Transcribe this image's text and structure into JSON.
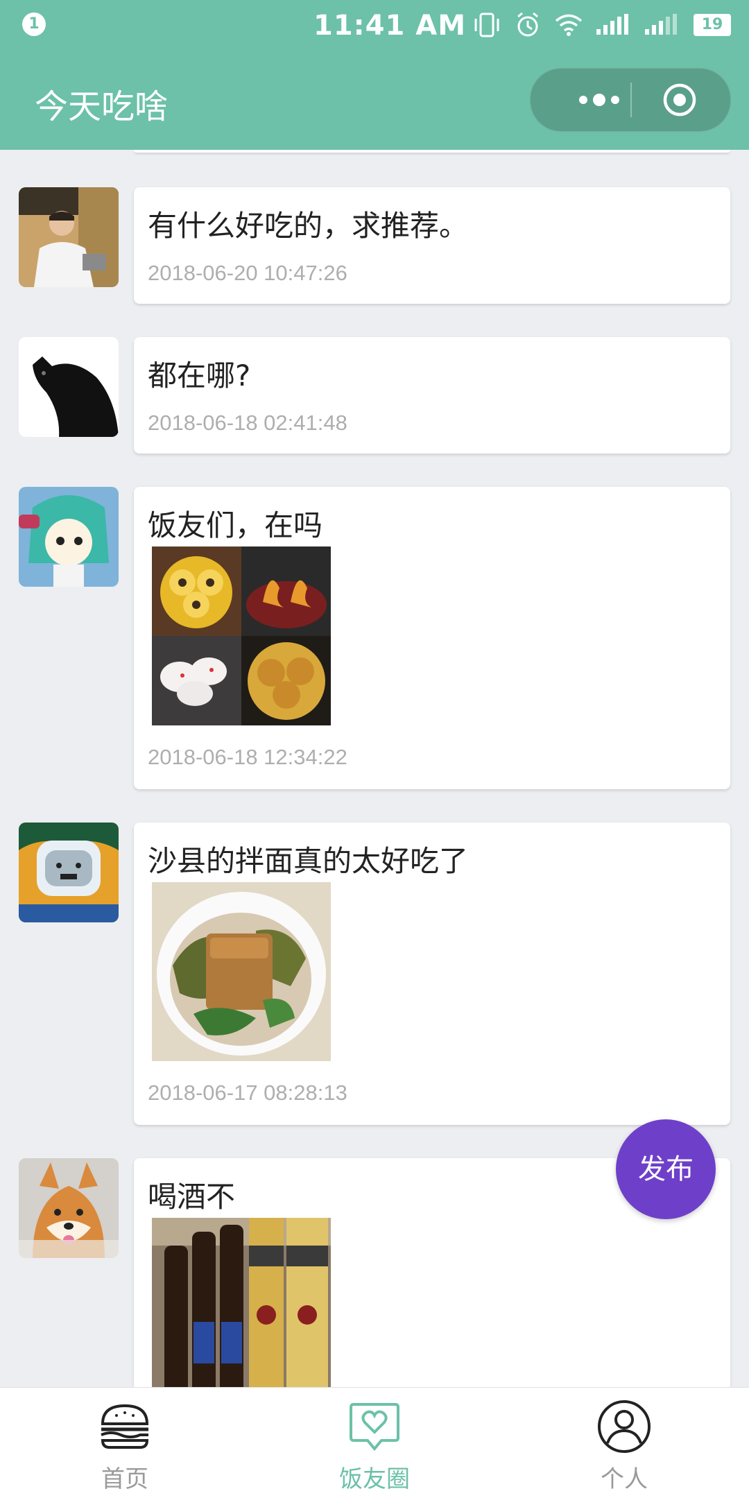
{
  "status_bar": {
    "notification_count": "1",
    "time": "11:41 AM",
    "battery": "19"
  },
  "nav": {
    "title": "今天吃啥"
  },
  "posts": [
    {
      "text": "有什么好吃的，求推荐。",
      "time": "2018-06-20 10:47:26"
    },
    {
      "text": "都在哪?",
      "time": "2018-06-18 02:41:48"
    },
    {
      "text": "饭友们，在吗",
      "time": "2018-06-18 12:34:22"
    },
    {
      "text": "沙县的拌面真的太好吃了",
      "time": "2018-06-17 08:28:13"
    },
    {
      "text": "喝酒不"
    }
  ],
  "fab": {
    "label": "发布"
  },
  "tabs": [
    {
      "label": "首页",
      "icon": "burger-icon"
    },
    {
      "label": "饭友圈",
      "icon": "heart-chat-icon",
      "active": true
    },
    {
      "label": "个人",
      "icon": "person-icon"
    }
  ],
  "colors": {
    "theme": "#6cc1a8",
    "fab": "#6e40c9",
    "background": "#eceef1"
  }
}
